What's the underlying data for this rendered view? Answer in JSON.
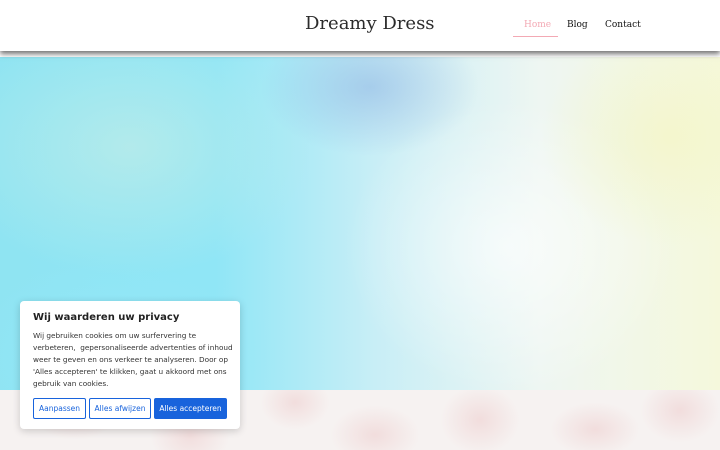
{
  "header": {
    "site_title": "Dreamy Dress",
    "nav": [
      {
        "label": "Home",
        "active": true
      },
      {
        "label": "Blog",
        "active": false
      },
      {
        "label": "Contact",
        "active": false
      }
    ]
  },
  "cookie_banner": {
    "title": "Wij waarderen uw privacy",
    "text_lines": [
      "Wij gebruiken cookies om uw surfervering te",
      "verbeteren,  gepersonaliseerde advertenties of inhoud",
      "weer te geven en ons verkeer te analyseren. Door op",
      "'Alles accepteren' te klikken, gaat u akkoord met ons",
      "gebruik van cookies."
    ],
    "buttons": {
      "customize": "Aanpassen",
      "reject_all": "Alles afwijzen",
      "accept_all": "Alles accepteren"
    }
  },
  "colors": {
    "nav_active": "#f3a9b4",
    "button_primary": "#1863dc"
  }
}
